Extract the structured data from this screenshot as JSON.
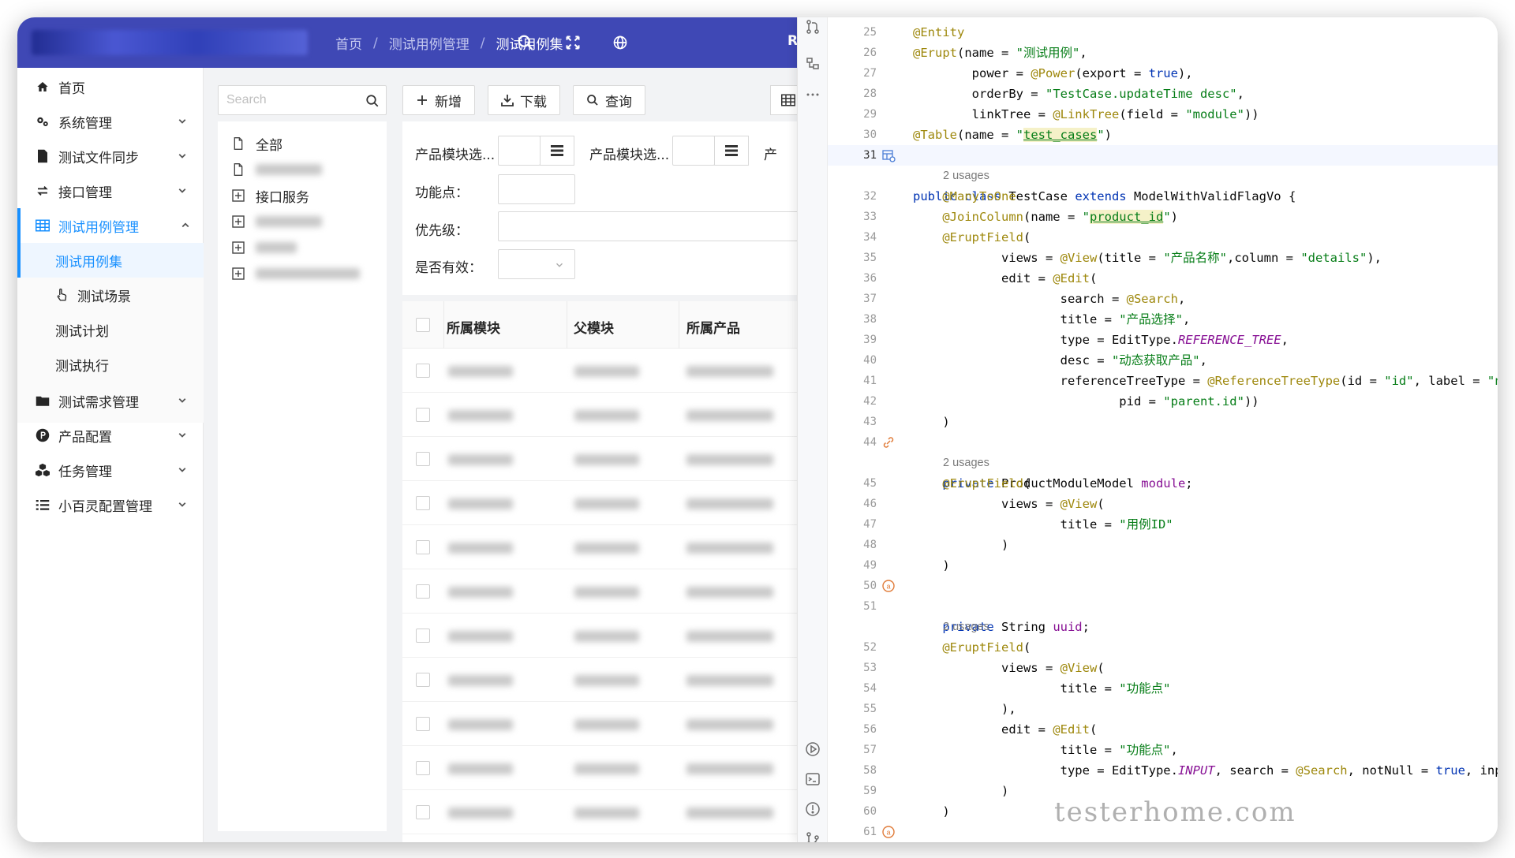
{
  "header": {
    "breadcrumb": [
      "首页",
      "测试用例管理",
      "测试用例集"
    ],
    "trailing_text": "R"
  },
  "sidebar": {
    "items": [
      {
        "label": "首页",
        "icon": "home-icon"
      },
      {
        "label": "系统管理",
        "icon": "gears-icon"
      },
      {
        "label": "测试文件同步",
        "icon": "file-icon"
      },
      {
        "label": "接口管理",
        "icon": "exchange-icon"
      },
      {
        "label": "测试用例管理",
        "icon": "table-icon"
      },
      {
        "label": "测试需求管理",
        "icon": "folder-icon"
      },
      {
        "label": "产品配置",
        "icon": "product-icon"
      },
      {
        "label": "任务管理",
        "icon": "cubes-icon"
      },
      {
        "label": "小百灵配置管理",
        "icon": "list-icon"
      }
    ],
    "subitems": [
      {
        "label": "测试用例集"
      },
      {
        "label": "测试场景",
        "icon": "hand-pointer-icon"
      },
      {
        "label": "测试计划"
      },
      {
        "label": "测试执行"
      }
    ]
  },
  "tree": {
    "search_placeholder": "Search",
    "items": [
      "全部",
      "",
      "接口服务",
      "",
      "",
      ""
    ]
  },
  "toolbar": {
    "add_label": "新增",
    "download_label": "下载",
    "query_label": "查询"
  },
  "form": {
    "product_module_1": "产品模块选...",
    "product_module_2": "产品模块选...",
    "product_trailing": "产",
    "feature": "功能点：",
    "priority": "优先级：",
    "valid": "是否有效："
  },
  "table": {
    "headers": [
      "所属模块",
      "父模块",
      "所属产品"
    ]
  },
  "ide": {
    "usages": "2 usages"
  },
  "watermark": "testerhome.com"
}
